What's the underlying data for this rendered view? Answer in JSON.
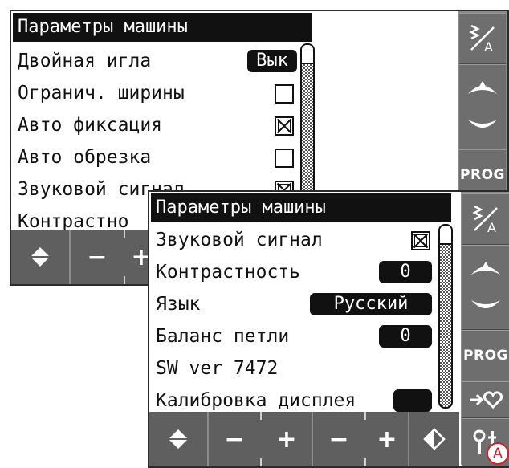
{
  "back_screen": {
    "title": "Параметры машины",
    "rows": [
      {
        "label": "Двойная игла",
        "value": "Вык"
      },
      {
        "label": "Огранич. ширины",
        "checked": false
      },
      {
        "label": "Авто фиксация",
        "checked": true
      },
      {
        "label": "Авто обрезка",
        "checked": false
      },
      {
        "label": "Звуковой сигнал",
        "checked": true
      },
      {
        "label": "Контрастно"
      }
    ],
    "sidebar": {
      "prog_label": "PROG"
    }
  },
  "front_screen": {
    "title": "Параметры машины",
    "rows": [
      {
        "label": "Звуковой сигнал",
        "checked": true
      },
      {
        "label": "Контрастность",
        "value": "0"
      },
      {
        "label": "Язык",
        "value": "Русский"
      },
      {
        "label": "Баланс петли",
        "value": "0"
      },
      {
        "label": "SW ver 7472"
      },
      {
        "label": "Калибровка дисплея"
      }
    ],
    "sidebar": {
      "prog_label": "PROG"
    }
  },
  "bottom_bar": {
    "minus": "−",
    "plus": "+"
  },
  "callout_label": "A",
  "colors": {
    "title_bg": "#111111",
    "sidebar": "#6e6e6e",
    "bottom_bar": "#5f5f5f",
    "callout": "#d0202a"
  }
}
